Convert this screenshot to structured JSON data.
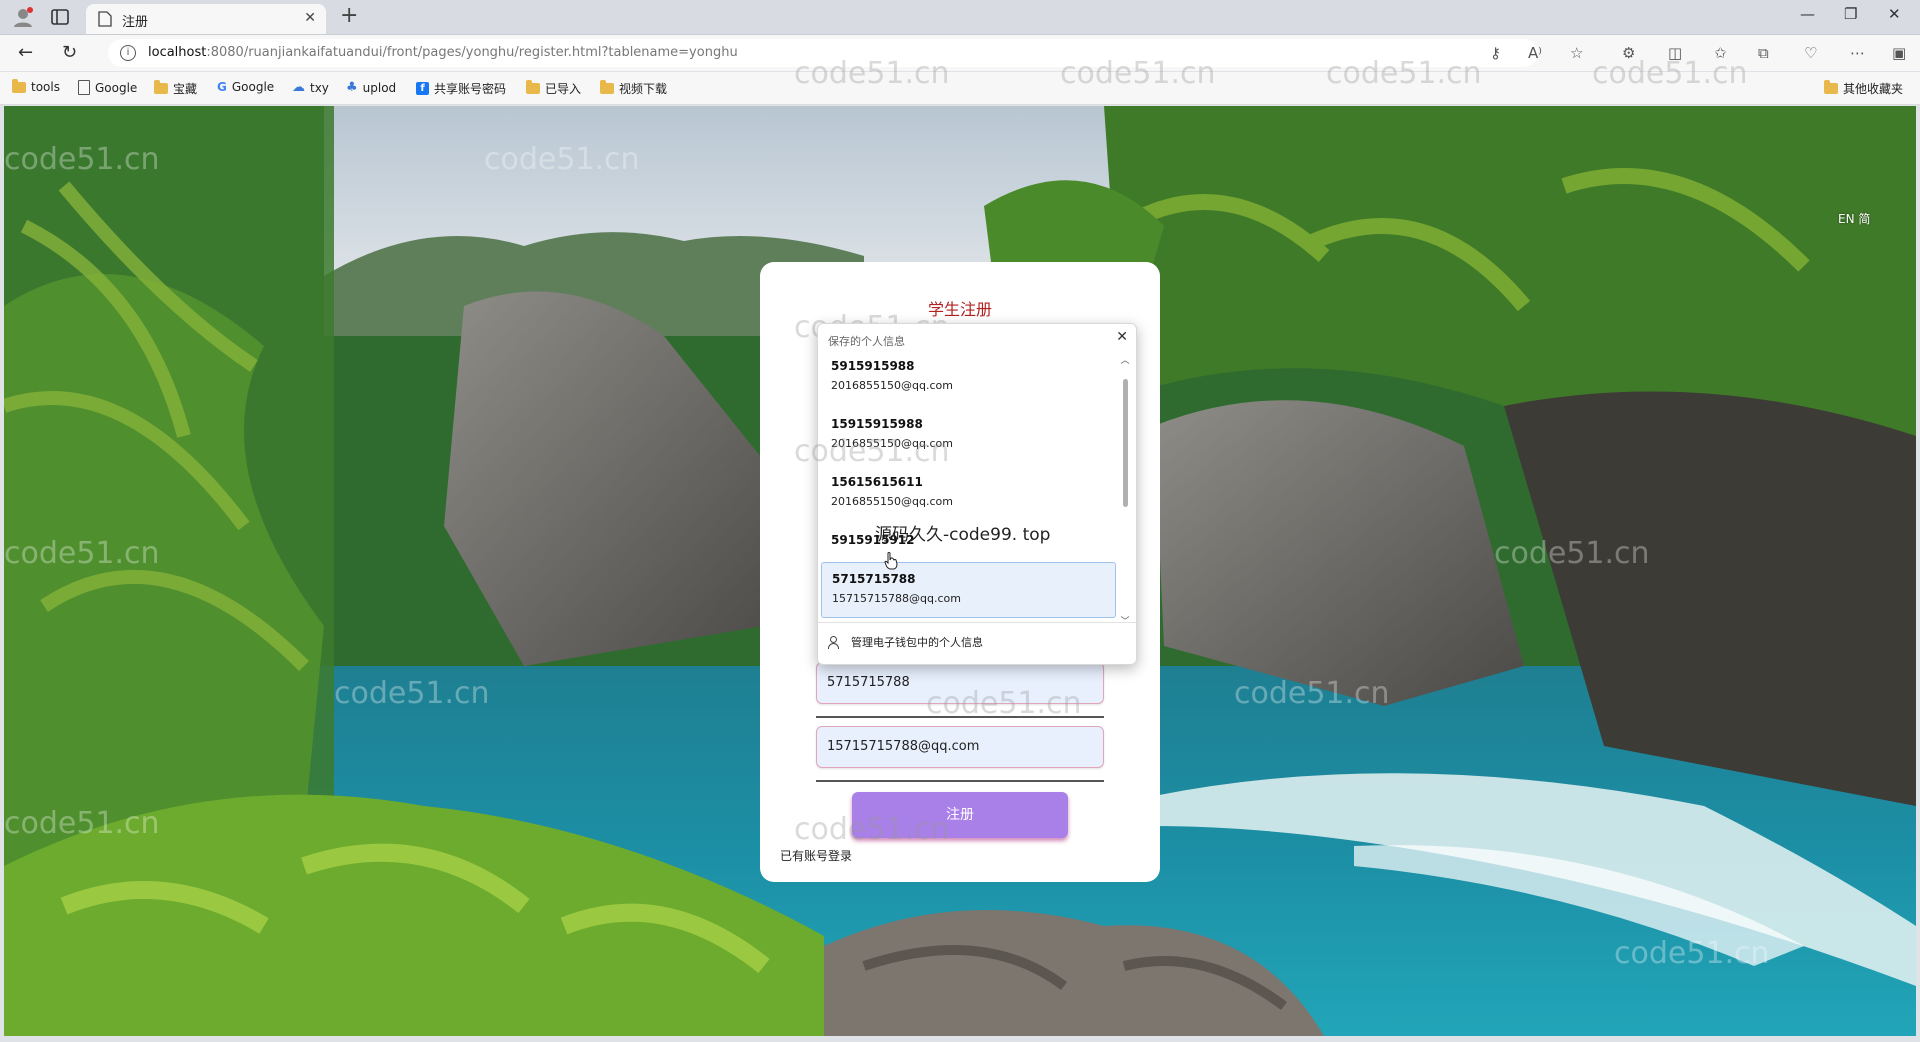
{
  "browser": {
    "tab_title": "注册",
    "url_host": "localhost",
    "url_rest": ":8080/ruanjiankaifatuandui/front/pages/yonghu/register.html?tablename=yonghu",
    "bookmarks": [
      "tools",
      "Google",
      "宝藏",
      "Google",
      "txy",
      "uplod",
      "共享账号密码",
      "已导入",
      "视频下载"
    ],
    "other_bookmarks": "其他收藏夹"
  },
  "page": {
    "lang_switch": "EN 简",
    "card_title": "学生注册",
    "phone_value": "5715715788",
    "email_value": "15715715788@qq.com",
    "register_label": "注册",
    "login_link": "已有账号登录"
  },
  "autofill": {
    "header": "保存的个人信息",
    "items": [
      {
        "main": "5915915988",
        "sub": "2016855150@qq.com"
      },
      {
        "main": "15915915988",
        "sub": "2016855150@qq.com"
      },
      {
        "main": "15615615611",
        "sub": "2016855150@qq.com"
      },
      {
        "main": "5915915912",
        "sub": ""
      },
      {
        "main": "5715715788",
        "sub": "15715715788@qq.com"
      }
    ],
    "footer": "管理电子钱包中的个人信息"
  },
  "overlay_caption": "源码久久-code99. top",
  "watermark": "code51.cn",
  "colors": {
    "card_title": "#b11f1f",
    "register_button": "#a980e8",
    "field_fill": "#e8f0fe",
    "field_border": "#e2a6bc"
  }
}
